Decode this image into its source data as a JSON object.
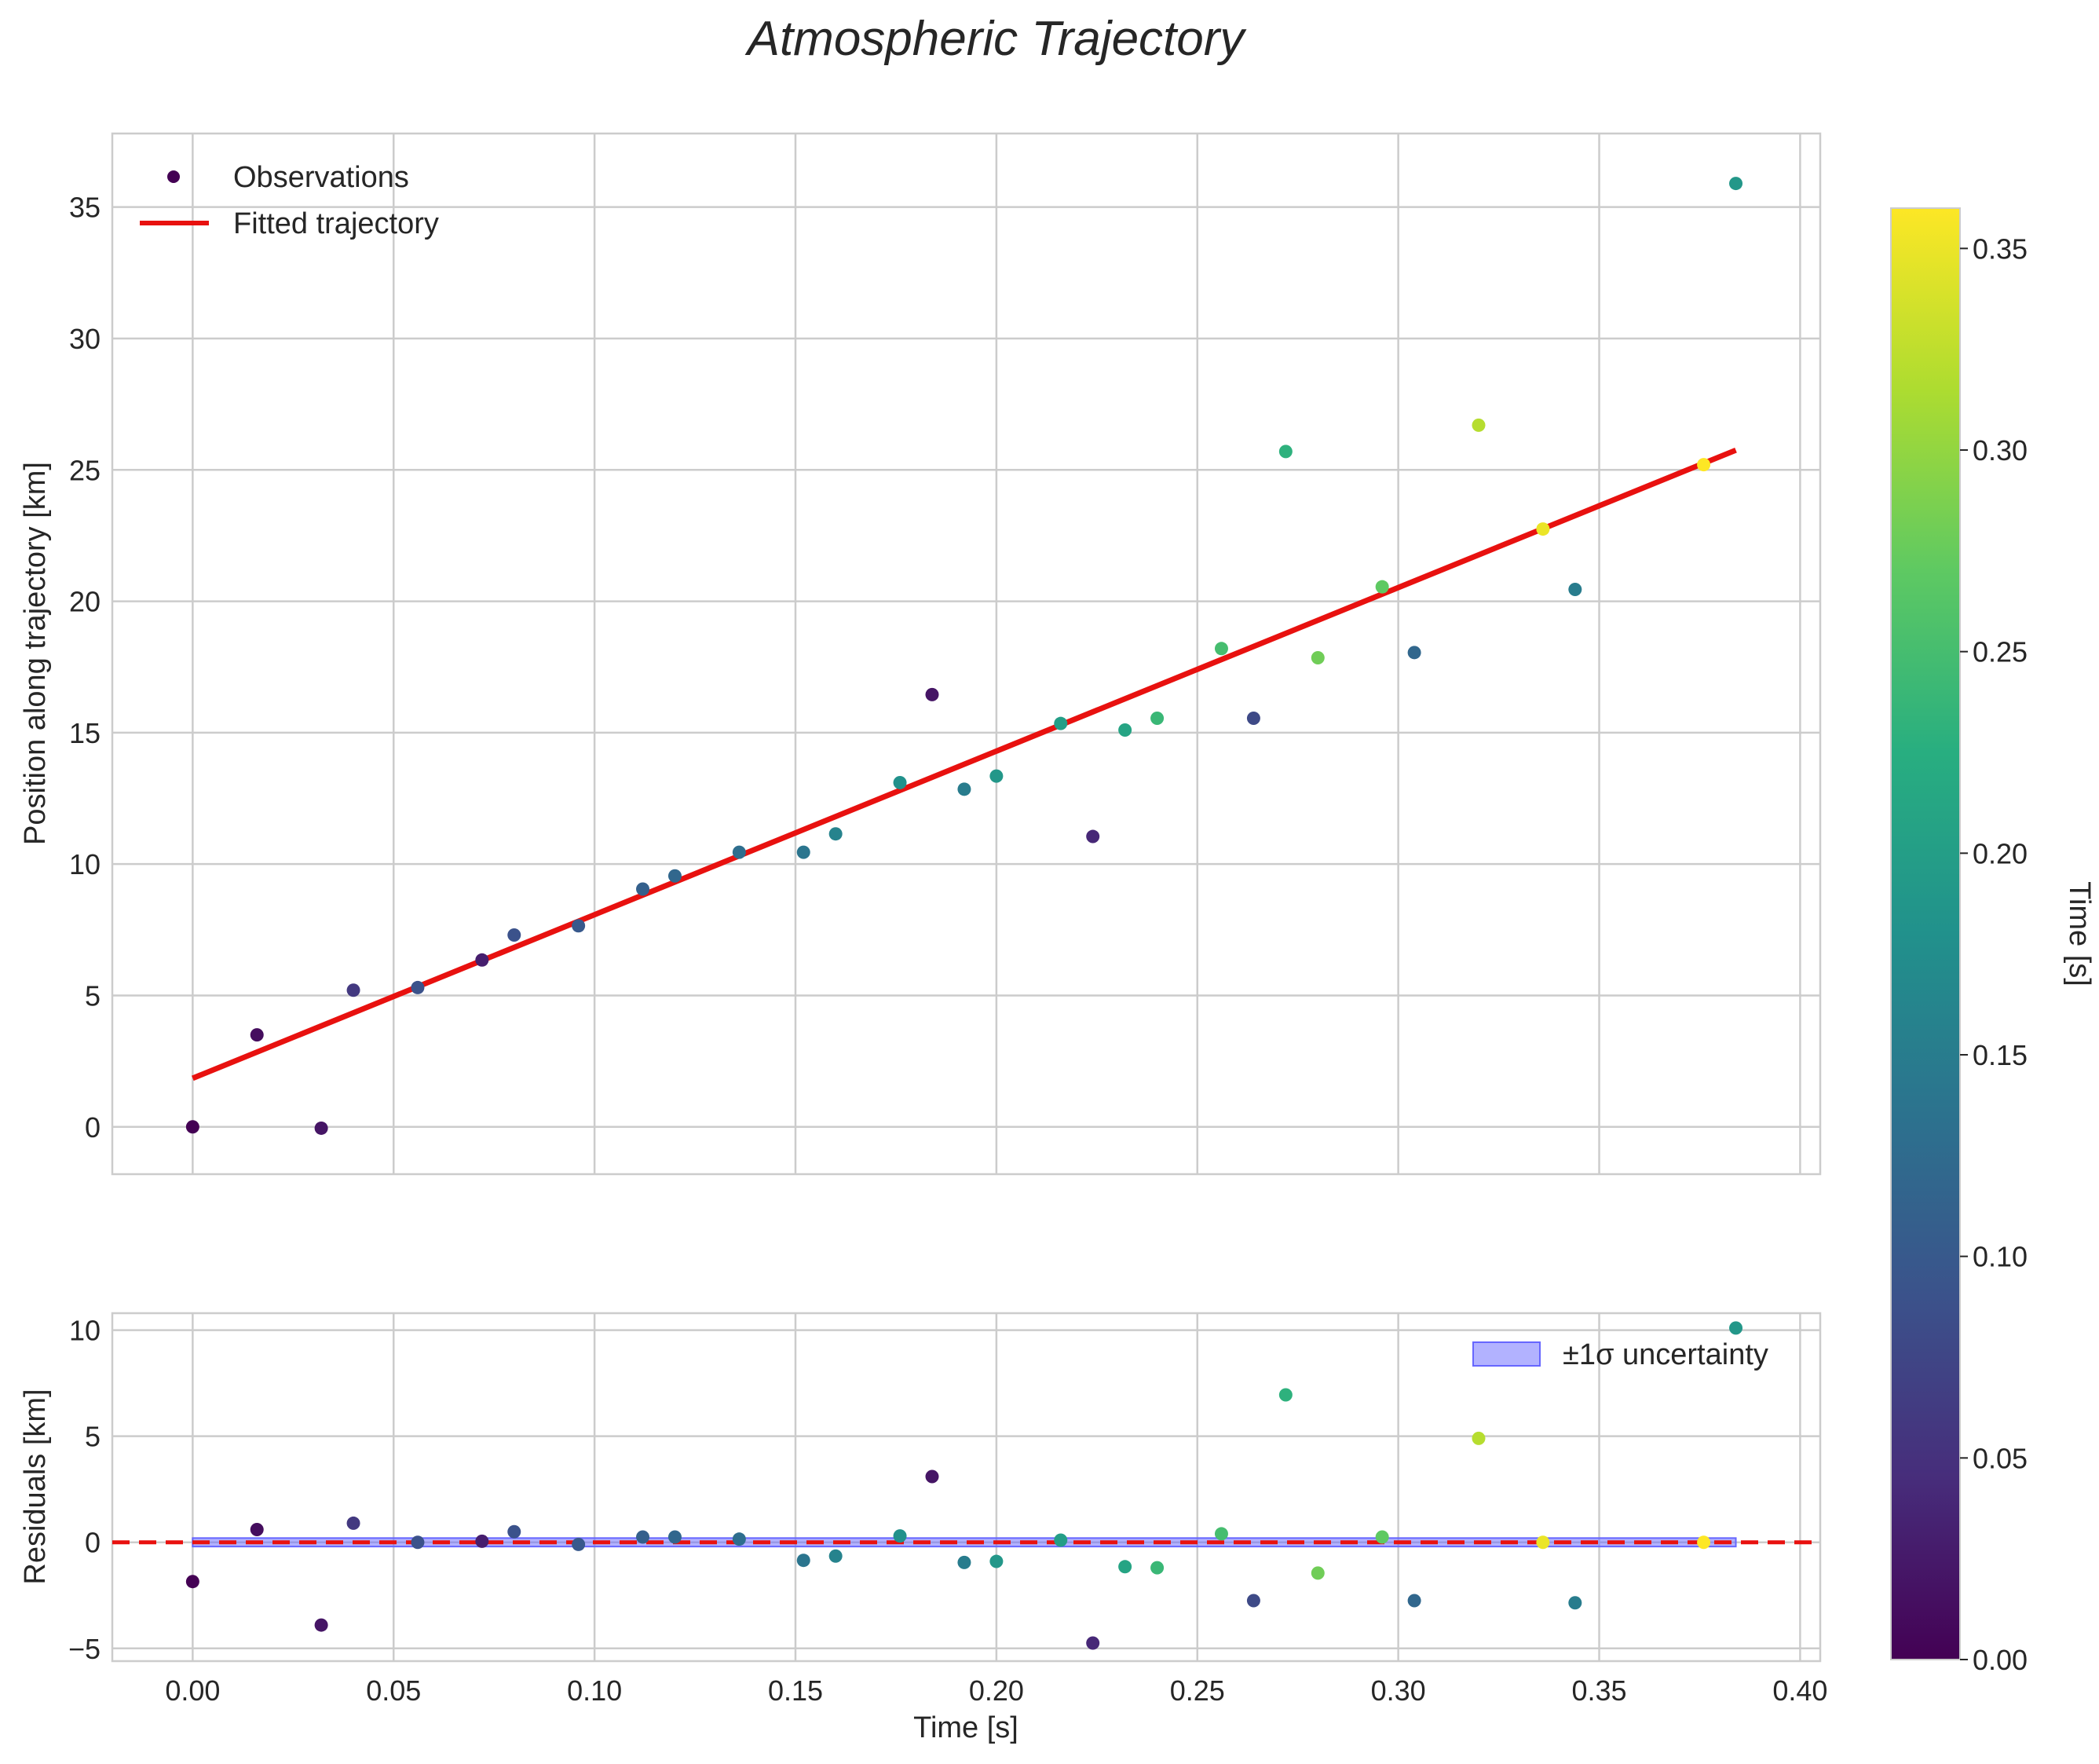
{
  "chart_data": {
    "type": "scatter",
    "title": "Atmospheric Trajectory",
    "xlabel": "Time [s]",
    "xlim": [
      -0.02,
      0.405
    ],
    "xticks": [
      0.0,
      0.05,
      0.1,
      0.15,
      0.2,
      0.25,
      0.3,
      0.35,
      0.4
    ],
    "xtick_labels": [
      "0.00",
      "0.05",
      "0.10",
      "0.15",
      "0.20",
      "0.25",
      "0.30",
      "0.35",
      "0.40"
    ],
    "grid": true,
    "colormap": "viridis",
    "colorbar": {
      "label": "Time [s]",
      "range": [
        0.0,
        0.36
      ],
      "ticks": [
        0.0,
        0.05,
        0.1,
        0.15,
        0.2,
        0.25,
        0.3,
        0.35
      ],
      "tick_labels": [
        "0.00",
        "0.05",
        "0.10",
        "0.15",
        "0.20",
        "0.25",
        "0.30",
        "0.35"
      ]
    },
    "main_panel": {
      "ylabel": "Position along trajectory [km]",
      "ylim": [
        -1.8,
        37.8
      ],
      "yticks": [
        0,
        5,
        10,
        15,
        20,
        25,
        30,
        35
      ],
      "ytick_labels": [
        "0",
        "5",
        "10",
        "15",
        "20",
        "25",
        "30",
        "35"
      ],
      "legend_position": "upper-left",
      "series": [
        {
          "name": "Observations",
          "kind": "scatter",
          "points": [
            {
              "t": 0.0,
              "pos": 0.0,
              "c": 0.0
            },
            {
              "t": 0.016,
              "pos": 3.5,
              "c": 0.012
            },
            {
              "t": 0.032,
              "pos": -0.05,
              "c": 0.02
            },
            {
              "t": 0.04,
              "pos": 5.2,
              "c": 0.06
            },
            {
              "t": 0.056,
              "pos": 5.3,
              "c": 0.09
            },
            {
              "t": 0.072,
              "pos": 6.35,
              "c": 0.03
            },
            {
              "t": 0.08,
              "pos": 7.3,
              "c": 0.09
            },
            {
              "t": 0.096,
              "pos": 7.65,
              "c": 0.1
            },
            {
              "t": 0.112,
              "pos": 9.05,
              "c": 0.11
            },
            {
              "t": 0.12,
              "pos": 9.55,
              "c": 0.12
            },
            {
              "t": 0.136,
              "pos": 10.45,
              "c": 0.13
            },
            {
              "t": 0.152,
              "pos": 10.45,
              "c": 0.14
            },
            {
              "t": 0.16,
              "pos": 11.15,
              "c": 0.16
            },
            {
              "t": 0.176,
              "pos": 13.1,
              "c": 0.18
            },
            {
              "t": 0.184,
              "pos": 16.45,
              "c": 0.02
            },
            {
              "t": 0.192,
              "pos": 12.85,
              "c": 0.15
            },
            {
              "t": 0.2,
              "pos": 13.35,
              "c": 0.19
            },
            {
              "t": 0.216,
              "pos": 15.35,
              "c": 0.2
            },
            {
              "t": 0.224,
              "pos": 11.05,
              "c": 0.04
            },
            {
              "t": 0.232,
              "pos": 15.1,
              "c": 0.21
            },
            {
              "t": 0.24,
              "pos": 15.55,
              "c": 0.24
            },
            {
              "t": 0.256,
              "pos": 18.2,
              "c": 0.25
            },
            {
              "t": 0.264,
              "pos": 15.55,
              "c": 0.08
            },
            {
              "t": 0.272,
              "pos": 25.7,
              "c": 0.23
            },
            {
              "t": 0.28,
              "pos": 17.85,
              "c": 0.28
            },
            {
              "t": 0.296,
              "pos": 20.55,
              "c": 0.27
            },
            {
              "t": 0.304,
              "pos": 18.05,
              "c": 0.12
            },
            {
              "t": 0.32,
              "pos": 26.7,
              "c": 0.32
            },
            {
              "t": 0.336,
              "pos": 22.75,
              "c": 0.35
            },
            {
              "t": 0.344,
              "pos": 20.45,
              "c": 0.15
            },
            {
              "t": 0.376,
              "pos": 25.2,
              "c": 0.36
            },
            {
              "t": 0.384,
              "pos": 35.9,
              "c": 0.19
            }
          ]
        },
        {
          "name": "Fitted trajectory",
          "kind": "line",
          "color": "#e8110f",
          "x": [
            0.0,
            0.384
          ],
          "y": [
            1.85,
            25.75
          ]
        }
      ]
    },
    "residual_panel": {
      "ylabel": "Residuals [km]",
      "ylim": [
        -5.6,
        10.8
      ],
      "yticks": [
        -5,
        0,
        5,
        10
      ],
      "ytick_labels": [
        "−5",
        "0",
        "5",
        "10"
      ],
      "legend_position": "upper-right",
      "zero_line_color": "#e8110f",
      "band": {
        "name": "±1σ uncertainty",
        "color": "#6666ff",
        "x": [
          0.0,
          0.384
        ],
        "sigma": 0.2
      },
      "residuals": [
        -1.85,
        0.6,
        -3.9,
        0.9,
        0.0,
        0.05,
        0.5,
        -0.1,
        0.25,
        0.25,
        0.15,
        -0.85,
        -0.65,
        0.3,
        3.1,
        -0.95,
        -0.9,
        0.1,
        -4.75,
        -1.15,
        -1.2,
        0.4,
        -2.75,
        6.95,
        -1.45,
        0.25,
        -2.75,
        4.9,
        0.0,
        -2.85,
        0.0,
        10.1
      ]
    }
  }
}
